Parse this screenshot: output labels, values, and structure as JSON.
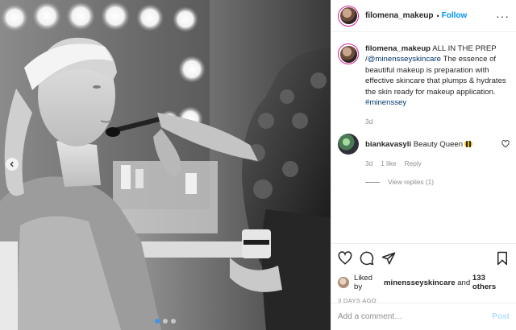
{
  "header": {
    "username": "filomena_makeup",
    "separator": "•",
    "follow_label": "Follow",
    "more_label": "···"
  },
  "caption": {
    "username": "filomena_makeup",
    "text_lead": "ALL IN THE PREP /",
    "mention": "@minensseyskincare",
    "text_body": "The essence of beautiful makeup is preparation with effective skincare that plumps & hydrates the skin ready for makeup application.",
    "hashtag": "#minenssey",
    "age": "3d"
  },
  "comment": {
    "username": "biankavasyli",
    "text": "Beauty Queen",
    "emoji": "bee-emoji",
    "age": "3d",
    "likes": "1 like",
    "reply_label": "Reply",
    "view_replies": "View replies (1)"
  },
  "actions": {
    "icons": [
      "heart-icon",
      "comment-icon",
      "share-icon",
      "bookmark-icon"
    ]
  },
  "likes": {
    "prefix": "Liked by",
    "user": "minensseyskincare",
    "and": "and",
    "others": "133 others"
  },
  "post_date": "3 DAYS AGO",
  "comment_box": {
    "placeholder": "Add a comment…",
    "post_label": "Post"
  },
  "photo": {
    "description_icon": "carousel-previous-icon",
    "carousel_count": 3,
    "active_index": 0
  },
  "colors": {
    "follow": "#0095f6",
    "post_disabled": "#b2dffc",
    "muted": "#8e8e8e",
    "link": "#00376b"
  }
}
